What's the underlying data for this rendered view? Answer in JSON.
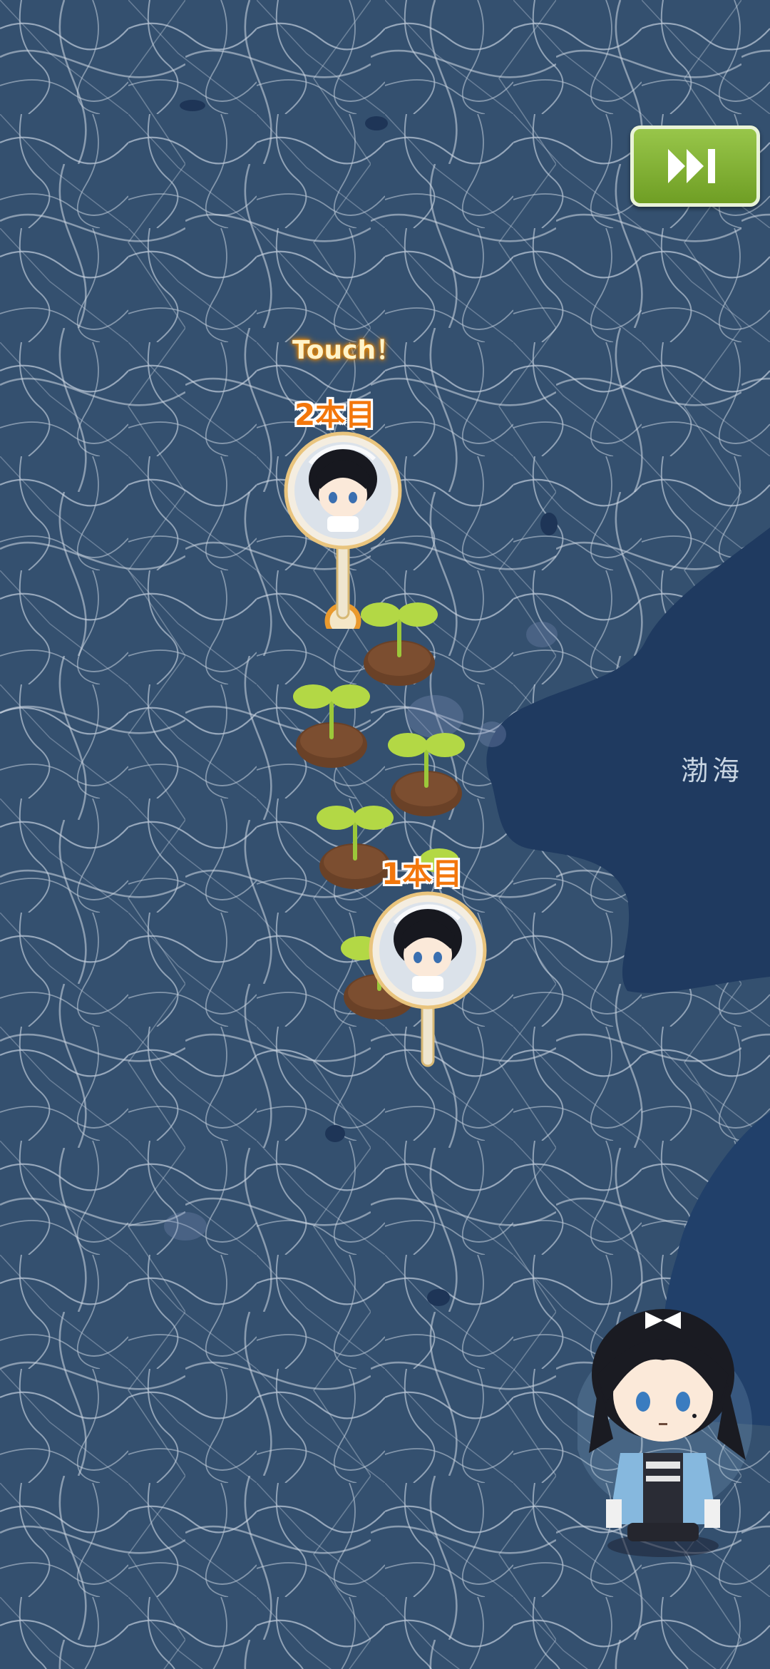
{
  "map": {
    "sea_label": "渤海",
    "colors": {
      "land": "#34506f",
      "sea": "#1f3a60",
      "roads": "#c4cfdc"
    }
  },
  "controls": {
    "skip_icon": "fast-forward-icon",
    "accent": "#7fb135"
  },
  "hint": {
    "touch": "Touch！"
  },
  "pins": [
    {
      "label": "2本目",
      "icon": "character-avatar-pin"
    },
    {
      "label": "1本目",
      "icon": "character-avatar-pin"
    }
  ],
  "seedlings": {
    "count": 6,
    "icon": "sprout-icon"
  },
  "character": {
    "icon": "chibi-character"
  }
}
